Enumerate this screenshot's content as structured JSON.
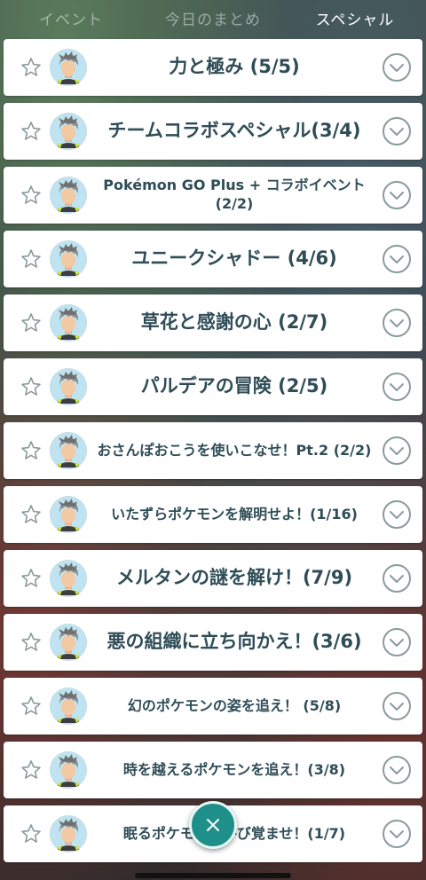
{
  "tabs": [
    {
      "label": "イベント",
      "active": false
    },
    {
      "label": "今日のまとめ",
      "active": false
    },
    {
      "label": "スペシャル",
      "active": true
    }
  ],
  "research_items": [
    {
      "title": "力と極み (5/5)",
      "size": "large"
    },
    {
      "title": "チームコラボスペシャル(3/4)",
      "size": "large"
    },
    {
      "title": "Pokémon GO Plus + コラボイベント (2/2)",
      "size": "small"
    },
    {
      "title": "ユニークシャドー (4/6)",
      "size": "large"
    },
    {
      "title": "草花と感謝の心 (2/7)",
      "size": "large"
    },
    {
      "title": "パルデアの冒険 (2/5)",
      "size": "large"
    },
    {
      "title": "おさんぽおこうを使いこなせ！Pt.2 (2/2)",
      "size": "small"
    },
    {
      "title": "いたずらポケモンを解明せよ！(1/16)",
      "size": "small"
    },
    {
      "title": "メルタンの謎を解け！(7/9)",
      "size": "large"
    },
    {
      "title": "悪の組織に立ち向かえ！(3/6)",
      "size": "large"
    },
    {
      "title": "幻のポケモンの姿を追え！ (5/8)",
      "size": "small"
    },
    {
      "title": "時を越えるポケモンを追え！(3/8)",
      "size": "small"
    },
    {
      "title": "眠るポケモンを呼び覚ませ！(1/7)",
      "size": "small"
    }
  ],
  "icons": {
    "favorite": "star-outline-icon",
    "expand": "chevron-down-circle-icon",
    "close": "close-icon",
    "avatar": "professor-willow-avatar"
  },
  "colors": {
    "accent_teal": "#1f8f8a",
    "title_text": "#2f4d57",
    "chevron": "#8a9a9f"
  }
}
